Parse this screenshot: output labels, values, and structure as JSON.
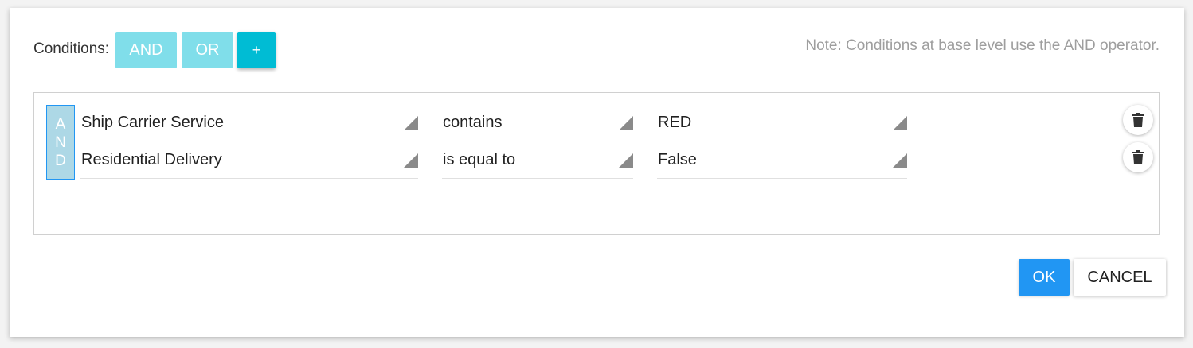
{
  "header": {
    "conditions_label": "Conditions:",
    "and_label": "AND",
    "or_label": "OR",
    "add_label": "+",
    "note": "Note: Conditions at base level use the AND operator."
  },
  "group": {
    "operator_letters": [
      "A",
      "N",
      "D"
    ]
  },
  "rules": [
    {
      "field": "Ship Carrier Service",
      "operator": "contains",
      "value": "RED"
    },
    {
      "field": "Residential Delivery",
      "operator": "is equal to",
      "value": "False"
    }
  ],
  "footer": {
    "ok_label": "OK",
    "cancel_label": "CANCEL"
  },
  "colors": {
    "accent": "#00bcd4",
    "accent_light": "#80deea",
    "primary": "#2196f3",
    "group_tag": "#add8e6"
  },
  "icons": {
    "delete": "trash-icon",
    "dropdown": "dropdown-arrow-icon"
  }
}
